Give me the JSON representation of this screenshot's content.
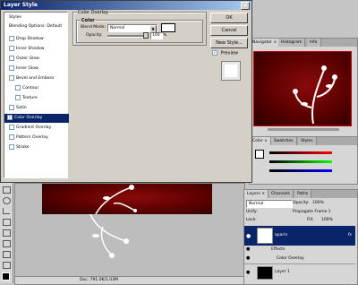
{
  "dialog": {
    "title": "Layer Style",
    "sidebar": {
      "styles": "Styles",
      "blending": "Blending Options: Default",
      "items": [
        {
          "label": "Drop Shadow",
          "indent": false
        },
        {
          "label": "Inner Shadow",
          "indent": false
        },
        {
          "label": "Outer Glow",
          "indent": false
        },
        {
          "label": "Inner Glow",
          "indent": false
        },
        {
          "label": "Bevel and Emboss",
          "indent": false
        },
        {
          "label": "Contour",
          "indent": true
        },
        {
          "label": "Texture",
          "indent": true
        },
        {
          "label": "Satin",
          "indent": false
        },
        {
          "label": "Color Overlay",
          "indent": false,
          "selected": true,
          "checked": true
        },
        {
          "label": "Gradient Overlay",
          "indent": false
        },
        {
          "label": "Pattern Overlay",
          "indent": false
        },
        {
          "label": "Stroke",
          "indent": false
        }
      ]
    },
    "section_title": "Color Overlay",
    "group_title": "Color",
    "blend_mode_label": "Blend Mode:",
    "blend_mode_value": "Normal",
    "opacity_label": "Opacity:",
    "opacity_value": "100",
    "opacity_unit": "%",
    "overlay_color": "#ffffff",
    "buttons": {
      "ok": "OK",
      "cancel": "Cancel",
      "new_style": "New Style...",
      "preview": "Preview"
    },
    "preview_checked": true
  },
  "navigator": {
    "tabs": [
      "Navigator ×",
      "Histogram",
      "Info"
    ]
  },
  "color_panel": {
    "tabs": [
      "Color ×",
      "Swatches",
      "Styles"
    ]
  },
  "layers": {
    "tabs": [
      "Layers ×",
      "Channels",
      "Paths"
    ],
    "blend_mode": "Normal",
    "opacity_label": "Opacity:",
    "opacity_value": "100%",
    "unify_label": "Unify:",
    "propagate_label": "Propagate Frame 1",
    "lock_label": "Lock:",
    "fill_label": "Fill:",
    "fill_value": "100%",
    "rows": [
      {
        "name": "aparin",
        "selected": true,
        "fx": true
      },
      {
        "name": "Effects",
        "sub": true
      },
      {
        "name": "Color Overlay",
        "sub": true
      },
      {
        "name": "Layer 1",
        "selected": false
      }
    ]
  },
  "canvas": {
    "status": "Doc: 791.0K/1.03M"
  },
  "colors": {
    "title_start": "#0a246a",
    "title_end": "#a6caf0",
    "selection": "#0a246a"
  }
}
